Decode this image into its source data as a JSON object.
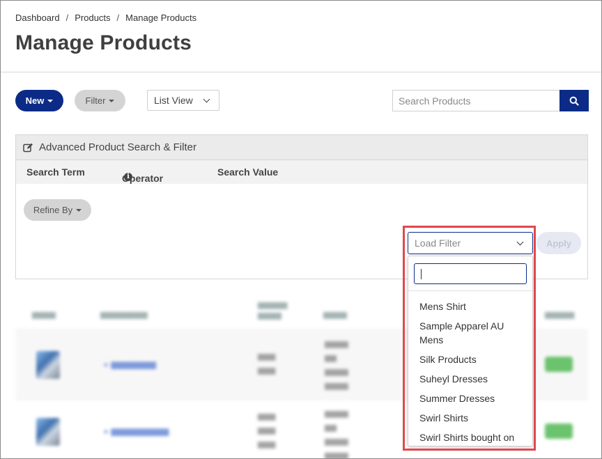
{
  "breadcrumb": {
    "items": [
      "Dashboard",
      "Products",
      "Manage Products"
    ],
    "separator": "/"
  },
  "page": {
    "title": "Manage Products"
  },
  "toolbar": {
    "new_label": "New",
    "filter_label": "Filter",
    "view_selected": "List View",
    "search_placeholder": "Search Products"
  },
  "advanced": {
    "title": "Advanced Product Search & Filter",
    "columns": {
      "term": "Search Term",
      "operator": "Operator",
      "value": "Search Value"
    },
    "refine_label": "Refine By",
    "apply_label": "Apply",
    "load_filter_placeholder": "Load Filter",
    "filter_options": [
      "Mens Shirt",
      "Sample Apparel AU Mens",
      "Silk Products",
      "Suheyl Dresses",
      "Summer Dresses",
      "Swirl Shirts",
      "Swirl Shirts bought on"
    ]
  },
  "colors": {
    "primary": "#0c2b86",
    "highlight": "#e0484f",
    "pill_grey": "#d4d4d4"
  },
  "icons": {
    "edit": "edit-icon",
    "search": "search-icon",
    "info": "info-icon",
    "chevron": "chevron-down-icon"
  }
}
